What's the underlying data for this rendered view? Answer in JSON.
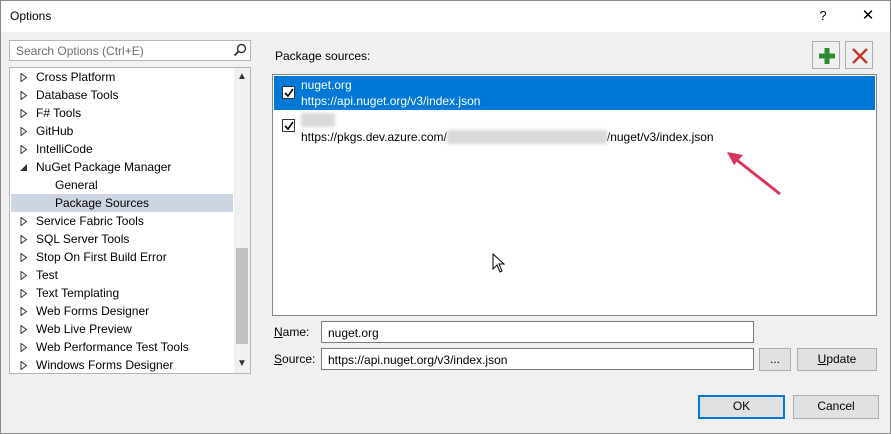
{
  "window": {
    "title": "Options",
    "help": "?",
    "close": "✕"
  },
  "search": {
    "placeholder": "Search Options (Ctrl+E)"
  },
  "tree": {
    "items": [
      {
        "label": "Cross Platform",
        "expander": "collapsed"
      },
      {
        "label": "Database Tools",
        "expander": "collapsed"
      },
      {
        "label": "F# Tools",
        "expander": "collapsed"
      },
      {
        "label": "GitHub",
        "expander": "collapsed"
      },
      {
        "label": "IntelliCode",
        "expander": "collapsed"
      },
      {
        "label": "NuGet Package Manager",
        "expander": "expanded"
      },
      {
        "label": "General",
        "expander": "none"
      },
      {
        "label": "Package Sources",
        "expander": "none",
        "selected": true
      },
      {
        "label": "Service Fabric Tools",
        "expander": "collapsed"
      },
      {
        "label": "SQL Server Tools",
        "expander": "collapsed"
      },
      {
        "label": "Stop On First Build Error",
        "expander": "collapsed"
      },
      {
        "label": "Test",
        "expander": "collapsed"
      },
      {
        "label": "Text Templating",
        "expander": "collapsed"
      },
      {
        "label": "Web Forms Designer",
        "expander": "collapsed"
      },
      {
        "label": "Web Live Preview",
        "expander": "collapsed"
      },
      {
        "label": "Web Performance Test Tools",
        "expander": "collapsed"
      },
      {
        "label": "Windows Forms Designer",
        "expander": "collapsed"
      }
    ]
  },
  "package_sources": {
    "label": "Package sources:",
    "add_icon": "plus-icon",
    "remove_icon": "delete-x-icon",
    "items": [
      {
        "name": "nuget.org",
        "url": "https://api.nuget.org/v3/index.json",
        "checked": true,
        "selected": true
      },
      {
        "name": "",
        "url_prefix": "https://pkgs.dev.azure.com/",
        "url_suffix": "/nuget/v3/index.json",
        "checked": true,
        "selected": false
      }
    ]
  },
  "form": {
    "name_label": "Name:",
    "name_value": "nuget.org",
    "source_label": "Source:",
    "source_value": "https://api.nuget.org/v3/index.json",
    "browse_label": "...",
    "update_label": "Update"
  },
  "buttons": {
    "ok": "OK",
    "cancel": "Cancel"
  },
  "colors": {
    "selection": "#0078d7",
    "tree_selection": "#cdd5e3",
    "add_green": "#2a8c2a",
    "remove_red": "#c0392b",
    "annotation_arrow": "#d9345a"
  }
}
